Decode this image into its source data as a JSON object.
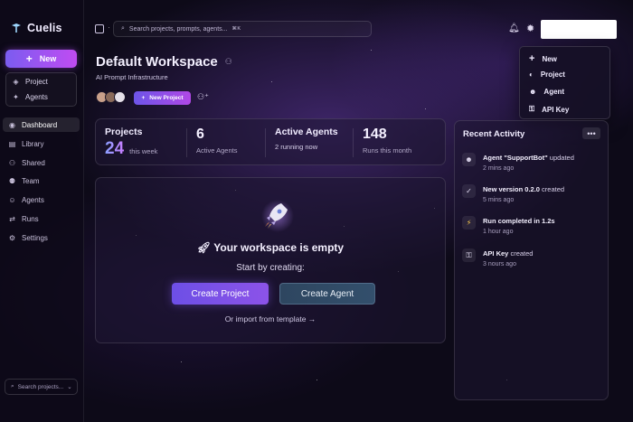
{
  "app": {
    "name": "Cuelis"
  },
  "sidebar": {
    "new_label": "New",
    "quick": [
      {
        "label": "Project",
        "icon": "cube-icon"
      },
      {
        "label": "Agents",
        "icon": "sparkles-icon"
      }
    ],
    "nav": [
      {
        "label": "Dashboard",
        "icon": "dashboard-icon",
        "active": true
      },
      {
        "label": "Library",
        "icon": "library-icon"
      },
      {
        "label": "Shared",
        "icon": "users-icon"
      },
      {
        "label": "Team",
        "icon": "team-icon"
      },
      {
        "label": "Agents",
        "icon": "bot-icon"
      },
      {
        "label": "Runs",
        "icon": "runs-icon"
      },
      {
        "label": "Settings",
        "icon": "gear-icon"
      }
    ],
    "search_placeholder": "Search projects..."
  },
  "topbar": {
    "search_placeholder": "Search projects, prompts, agents...",
    "shortcut": "⌘K"
  },
  "dropdown": {
    "items": [
      {
        "label": "New",
        "icon": "plus-icon"
      },
      {
        "label": "Project",
        "icon": "cube-icon"
      },
      {
        "label": "Agent",
        "icon": "agent-icon"
      },
      {
        "label": "API Key",
        "icon": "key-icon"
      }
    ]
  },
  "workspace": {
    "title": "Default Workspace",
    "subtitle": "AI Prompt Infrastructure",
    "new_project_label": "New Project"
  },
  "stats": {
    "projects": {
      "label": "Projects",
      "value": "24",
      "sub": "this week"
    },
    "agents": {
      "value": "6",
      "sub": "Active Agents"
    },
    "active_agents": {
      "label": "Active Agents",
      "sub": "2 running now"
    },
    "runs": {
      "value": "148",
      "sub": "Runs this month"
    }
  },
  "empty_state": {
    "title": "Your workspace is empty",
    "subtitle": "Start by creating:",
    "create_project": "Create Project",
    "create_agent": "Create Agent",
    "import_link": "Or import from template →"
  },
  "activity": {
    "title": "Recent Activity",
    "more": "•••",
    "items": [
      {
        "bold": "Agent \"SupportBot\"",
        "rest": " updated",
        "time": "2 mins ago",
        "icon": "agent-icon"
      },
      {
        "bold": "New version 0.2.0",
        "rest": " created",
        "time": "5 mins ago",
        "icon": "check-icon"
      },
      {
        "bold": "Run completed in 1.2s",
        "rest": "",
        "time": "1 hour ago",
        "icon": "bolt-icon"
      },
      {
        "bold": "API Key",
        "rest": " created",
        "time": "3 nours ago",
        "icon": "key-icon"
      }
    ]
  },
  "colors": {
    "accent_start": "#7b5cf0",
    "accent_end": "#c04cf2",
    "background": "#0d0a18",
    "agent_button": "#2e4660"
  }
}
